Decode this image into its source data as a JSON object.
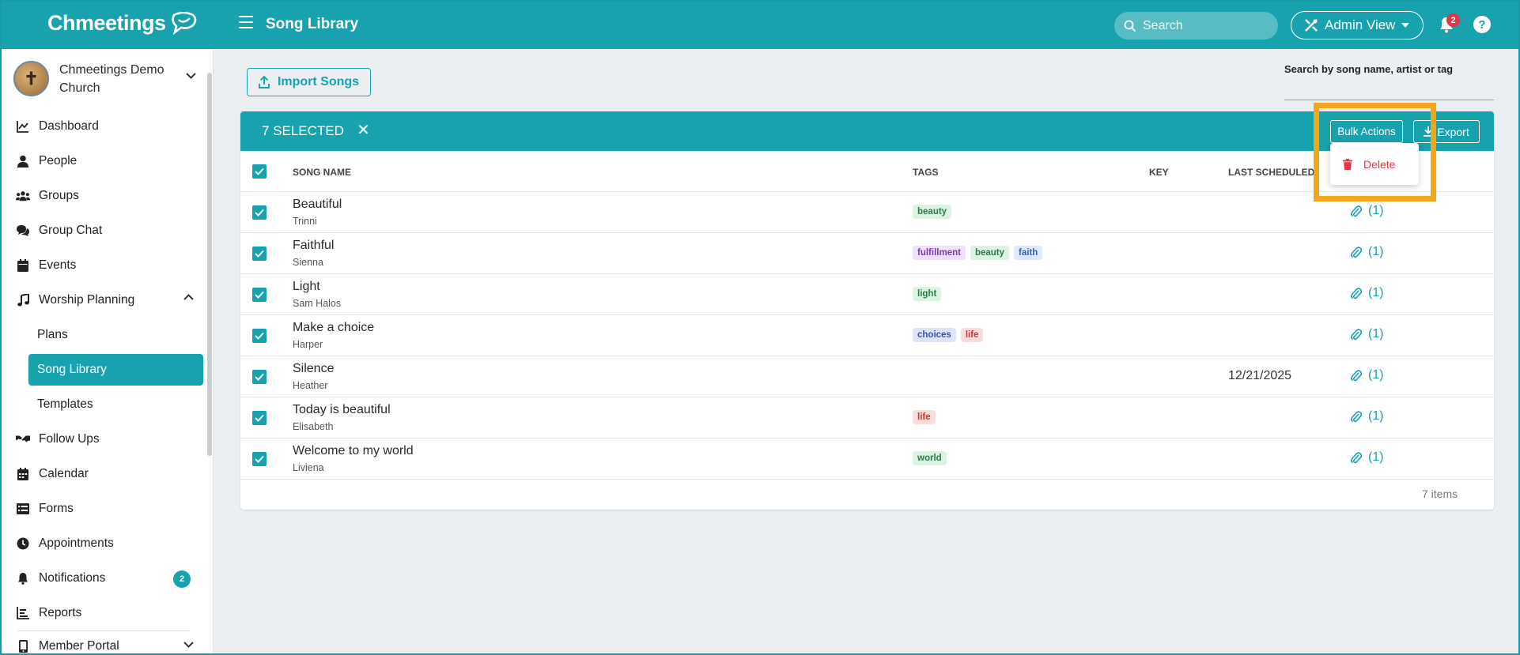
{
  "app": {
    "logo_text": "Chmeetings",
    "page_title": "Song Library"
  },
  "topbar": {
    "search_placeholder": "Search",
    "admin_view_label": "Admin View",
    "notification_count": "2",
    "help_label": "?"
  },
  "sidebar": {
    "church_name": "Chmeetings Demo Church",
    "items": [
      {
        "label": "Dashboard",
        "icon": "chart-line-icon"
      },
      {
        "label": "People",
        "icon": "person-icon"
      },
      {
        "label": "Groups",
        "icon": "users-icon"
      },
      {
        "label": "Group Chat",
        "icon": "comments-icon"
      },
      {
        "label": "Events",
        "icon": "calendar-icon"
      },
      {
        "label": "Worship Planning",
        "icon": "music-note-icon"
      },
      {
        "label": "Plans",
        "icon": ""
      },
      {
        "label": "Song Library",
        "icon": ""
      },
      {
        "label": "Templates",
        "icon": ""
      },
      {
        "label": "Follow Ups",
        "icon": "handshake-icon"
      },
      {
        "label": "Calendar",
        "icon": "calendar-grid-icon"
      },
      {
        "label": "Forms",
        "icon": "list-form-icon"
      },
      {
        "label": "Appointments",
        "icon": "clock-icon"
      },
      {
        "label": "Notifications",
        "icon": "bell-icon",
        "badge": "2"
      },
      {
        "label": "Reports",
        "icon": "report-icon"
      },
      {
        "label": "Member Portal",
        "icon": "mobile-icon"
      }
    ]
  },
  "main": {
    "import_label": "Import Songs",
    "search_label": "Search by song name, artist or tag",
    "selected_label": "7 SELECTED",
    "bulk_actions_label": "Bulk Actions",
    "export_label": "Export",
    "delete_label": "Delete",
    "columns": {
      "song_name": "SONG NAME",
      "tags": "TAGS",
      "key": "KEY",
      "last_scheduled": "LAST SCHEDULED"
    },
    "rows": [
      {
        "title": "Beautiful",
        "artist": "Trinni",
        "tags": [
          "beauty"
        ],
        "last": "",
        "attach": "(1)"
      },
      {
        "title": "Faithful",
        "artist": "Sienna",
        "tags": [
          "fulfillment",
          "beauty",
          "faith"
        ],
        "last": "",
        "attach": "(1)"
      },
      {
        "title": "Light",
        "artist": "Sam Halos",
        "tags": [
          "light"
        ],
        "last": "",
        "attach": "(1)"
      },
      {
        "title": "Make a choice",
        "artist": "Harper",
        "tags": [
          "choices",
          "life"
        ],
        "last": "",
        "attach": "(1)"
      },
      {
        "title": "Silence",
        "artist": "Heather",
        "tags": [],
        "last": "12/21/2025",
        "attach": "(1)"
      },
      {
        "title": "Today is beautiful",
        "artist": "Elisabeth",
        "tags": [
          "life"
        ],
        "last": "",
        "attach": "(1)"
      },
      {
        "title": "Welcome to my world",
        "artist": "Liviena",
        "tags": [
          "world"
        ],
        "last": "",
        "attach": "(1)"
      }
    ],
    "items_count": "7 items"
  },
  "tag_colors": {
    "beauty": {
      "bg": "#dcf3e3",
      "fg": "#2b7a47"
    },
    "fulfillment": {
      "bg": "#efe2fa",
      "fg": "#7b38b3"
    },
    "faith": {
      "bg": "#dde8fa",
      "fg": "#3a5fb8"
    },
    "light": {
      "bg": "#dcf3e3",
      "fg": "#2b7a47"
    },
    "choices": {
      "bg": "#dde4f8",
      "fg": "#3a4fa8"
    },
    "life": {
      "bg": "#fadcdc",
      "fg": "#c23a3a"
    },
    "world": {
      "bg": "#dcf3e3",
      "fg": "#2b7a47"
    }
  },
  "colors": {
    "brand": "#17a2ae",
    "danger": "#e53544",
    "highlight": "#f5a51a"
  }
}
